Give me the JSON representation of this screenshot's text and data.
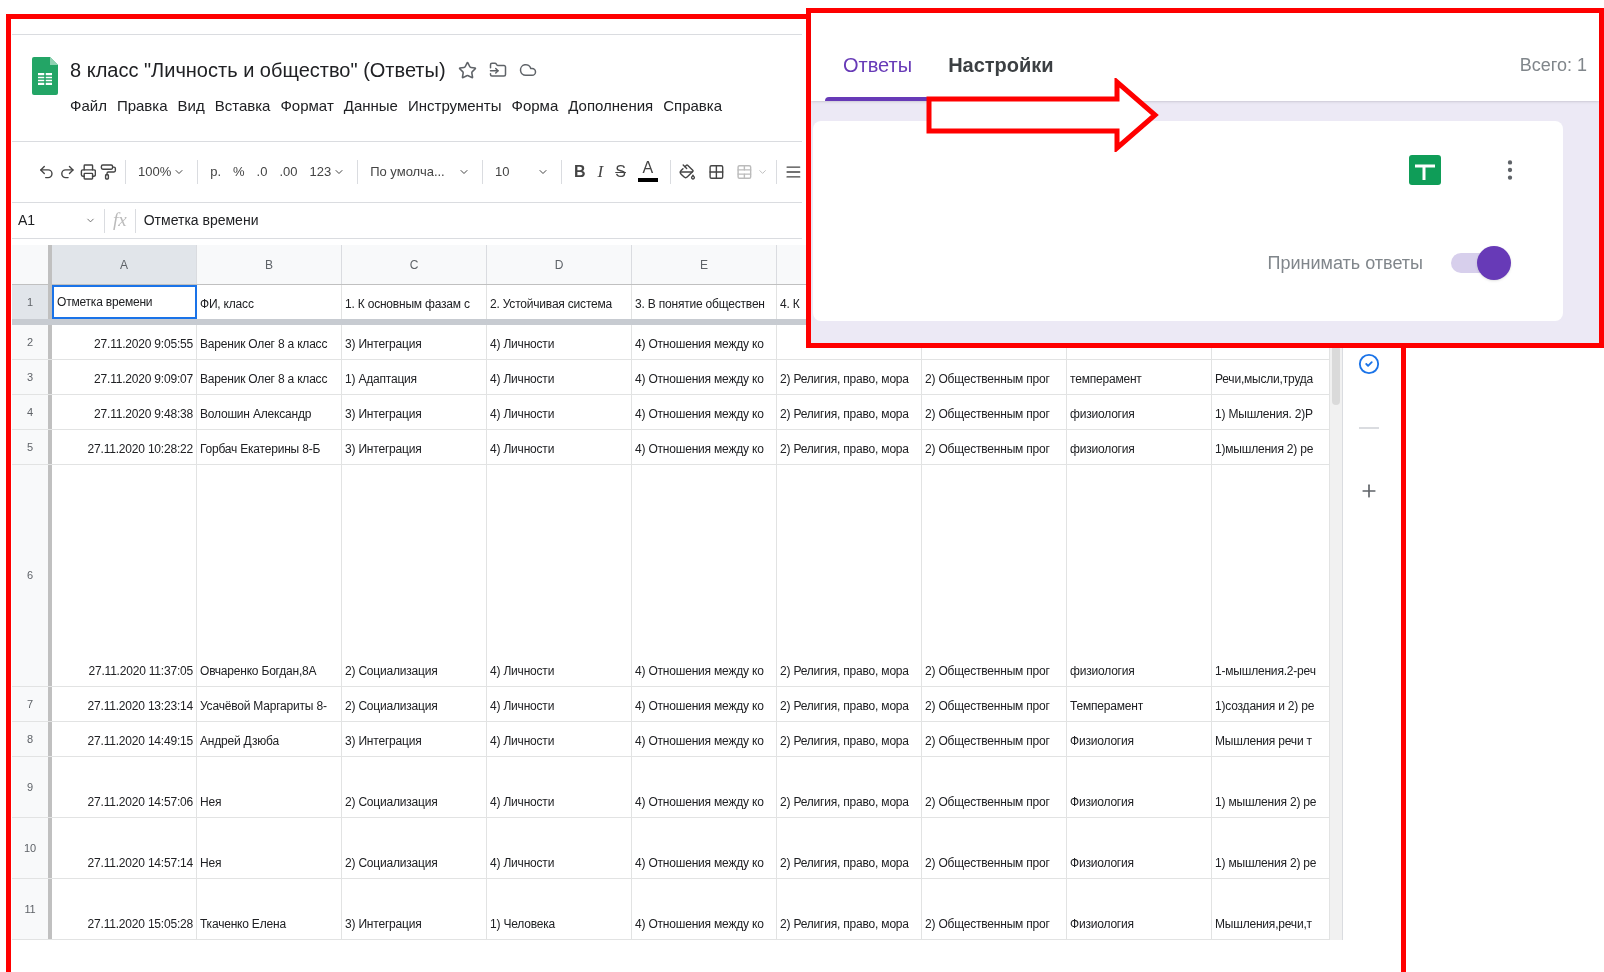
{
  "document": {
    "title": "8 класс \"Личность и общество\" (Ответы)",
    "menu": [
      "Файл",
      "Правка",
      "Вид",
      "Вставка",
      "Формат",
      "Данные",
      "Инструменты",
      "Форма",
      "Дополнения",
      "Справка"
    ]
  },
  "toolbar": {
    "zoom": "100%",
    "currency": "р.",
    "percent": "%",
    "decrease_decimals": ".0",
    "increase_decimals": ".00",
    "number_format": "123",
    "font": "По умолча...",
    "font_size": "10",
    "bold": "B",
    "italic": "I",
    "strikethrough": "S",
    "text_color": "A"
  },
  "formula_bar": {
    "cell_ref": "A1",
    "fx": "fx",
    "value": "Отметка времени"
  },
  "sheet": {
    "columns": [
      {
        "label": "A",
        "selected": true
      },
      {
        "label": "B",
        "selected": false
      },
      {
        "label": "C",
        "selected": false
      },
      {
        "label": "D",
        "selected": false
      },
      {
        "label": "E",
        "selected": false
      }
    ],
    "rows": [
      {
        "number": "1",
        "selected": true,
        "cells": [
          "Отметка времени",
          "ФИ, класс",
          "1. К основным фазам с",
          "2. Устойчивая система",
          "3. В понятие обществен",
          "4. К",
          "",
          "",
          ""
        ]
      },
      {
        "number": "2",
        "selected": false,
        "cells": [
          "27.11.2020 9:05:55",
          "Вареник Олег 8 а класс",
          "3) Интеграция",
          "4) Личности",
          "4) Отношения между ко",
          "",
          "",
          "",
          ""
        ]
      },
      {
        "number": "3",
        "selected": false,
        "cells": [
          "27.11.2020 9:09:07",
          "Вареник Олег 8 а класс",
          "1) Адаптация",
          "4) Личности",
          "4) Отношения между ко",
          "2) Религия, право, мора",
          "2) Общественным прог",
          "темперамент",
          "Речи,мысли,труда"
        ]
      },
      {
        "number": "4",
        "selected": false,
        "cells": [
          "27.11.2020 9:48:38",
          "Волошин Александр",
          "3) Интеграция",
          "4) Личности",
          "4) Отношения между ко",
          "2) Религия, право, мора",
          "2) Общественным прог",
          "физиология",
          "1) Мышления. 2)Р"
        ]
      },
      {
        "number": "5",
        "selected": false,
        "cells": [
          "27.11.2020 10:28:22",
          "Горбач Екатерины 8-Б",
          "3) Интеграция",
          "4) Личности",
          "4) Отношения между ко",
          "2) Религия, право, мора",
          "2) Общественным прог",
          "физиология",
          "1)мышления 2) ре"
        ]
      },
      {
        "number": "6",
        "selected": false,
        "cells": [
          "27.11.2020 11:37:05",
          "Овчаренко Богдан,8А",
          "2) Социализация",
          "4) Личности",
          "4) Отношения между ко",
          "2) Религия, право, мора",
          "2) Общественным прог",
          "физиология",
          "1-мышления.2-реч"
        ]
      },
      {
        "number": "7",
        "selected": false,
        "cells": [
          "27.11.2020 13:23:14",
          "Усачёвой Маргариты 8-",
          "2) Социализация",
          "4) Личности",
          "4) Отношения между ко",
          "2) Религия, право, мора",
          "2) Общественным прог",
          "Темперамент",
          "1)создания и 2) ре"
        ]
      },
      {
        "number": "8",
        "selected": false,
        "cells": [
          "27.11.2020 14:49:15",
          "Андрей Дзюба",
          "3) Интеграция",
          "4) Личности",
          "4) Отношения между ко",
          "2) Религия, право, мора",
          "2) Общественным прог",
          "Физиология",
          "Мышления речи т"
        ]
      },
      {
        "number": "9",
        "selected": false,
        "cells": [
          "27.11.2020 14:57:06",
          "Нея",
          "2) Социализация",
          "4) Личности",
          "4) Отношения между ко",
          "2) Религия, право, мора",
          "2) Общественным прог",
          "Физиология",
          "1) мышления 2) ре"
        ]
      },
      {
        "number": "10",
        "selected": false,
        "cells": [
          "27.11.2020 14:57:14",
          "Нея",
          "2) Социализация",
          "4) Личности",
          "4) Отношения между ко",
          "2) Религия, право, мора",
          "2) Общественным прог",
          "Физиология",
          "1) мышления 2) ре"
        ]
      },
      {
        "number": "11",
        "selected": false,
        "cells": [
          "27.11.2020 15:05:28",
          "Ткаченко Елена",
          "3) Интеграция",
          "1) Человека",
          "4) Отношения между ко",
          "2) Религия, право, мора",
          "2) Общественным прог",
          "Физиология",
          "Мышления,речи,т"
        ]
      }
    ]
  },
  "form_panel": {
    "tabs": [
      {
        "label": "Ответы",
        "selected": true
      },
      {
        "label": "Настройки",
        "selected": false
      }
    ],
    "total": "Всего: 1",
    "accept_responses": {
      "label": "Принимать ответы",
      "on": true
    }
  }
}
